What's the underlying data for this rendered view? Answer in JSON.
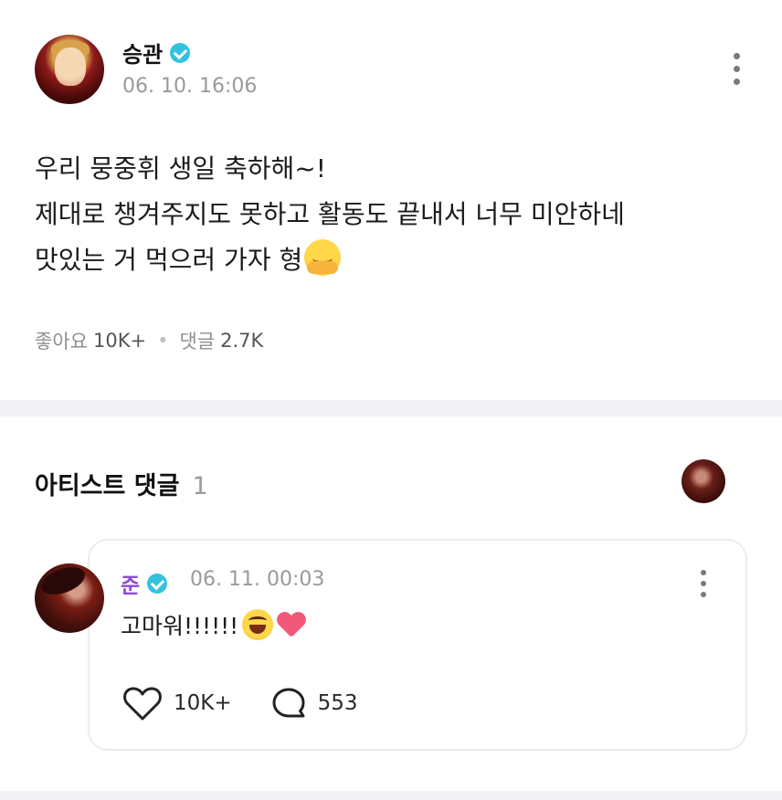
{
  "post": {
    "author": "승관",
    "time": "06. 10. 16:06",
    "lines": [
      "우리 뭉중휘 생일 축하해~!",
      "제대로 챙겨주지도 못하고 활동도 끝내서 너무 미안하네",
      "맛있는 거 먹으러 가자 형"
    ],
    "emoji": "smiling-face-with-open-hands",
    "likes_label": "좋아요",
    "likes_value": "10K+",
    "comments_label": "댓글",
    "comments_value": "2.7K"
  },
  "artist_comments": {
    "title": "아티스트 댓글",
    "count": "1",
    "comment": {
      "author": "준",
      "time": "06. 11. 00:03",
      "text": "고마워!!!!!!",
      "emojis": [
        "grinning-squinting-face",
        "pink-heart"
      ],
      "likes": "10K+",
      "replies": "553"
    }
  },
  "colors": {
    "verified": "#33c2de",
    "comment_author": "#8e4bd6",
    "heart": "#f2587a"
  },
  "icons": [
    "verified-badge-icon",
    "more-vertical-icon",
    "heart-icon",
    "reply-bubble-icon"
  ]
}
